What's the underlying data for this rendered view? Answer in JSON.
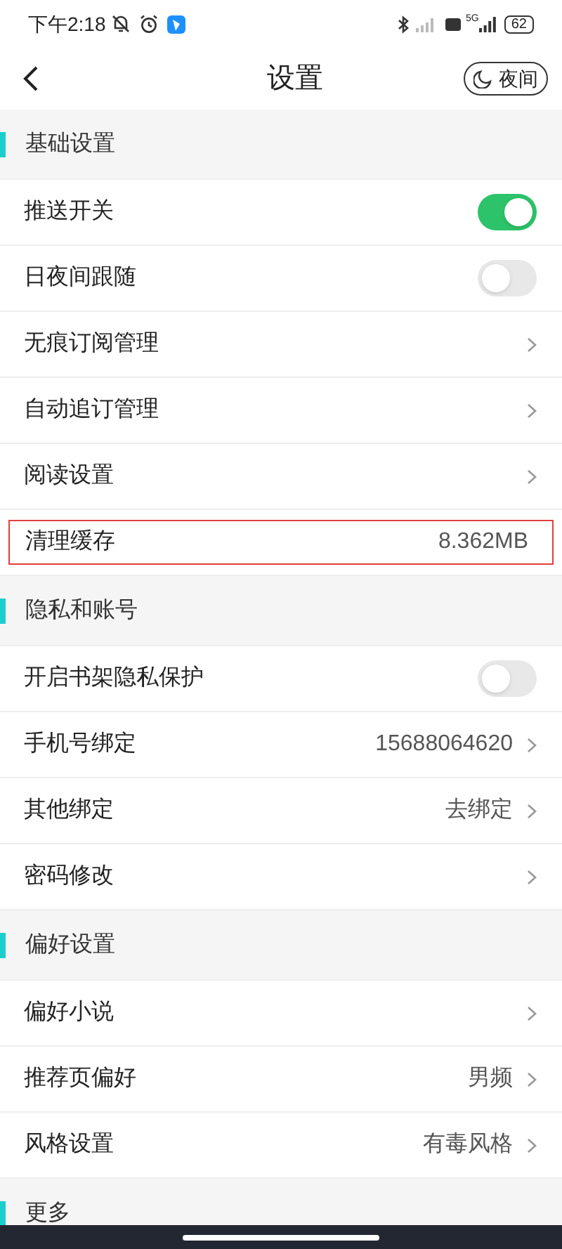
{
  "status_bar": {
    "time": "下午2:18",
    "network": "5G",
    "battery": "62"
  },
  "header": {
    "title": "设置",
    "night_button": "夜间"
  },
  "sections": [
    {
      "title": "基础设置",
      "items": [
        {
          "kind": "toggle",
          "label": "推送开关",
          "on": true
        },
        {
          "kind": "toggle",
          "label": "日夜间跟随",
          "on": false
        },
        {
          "kind": "link",
          "label": "无痕订阅管理"
        },
        {
          "kind": "link",
          "label": "自动追订管理"
        },
        {
          "kind": "link",
          "label": "阅读设置"
        },
        {
          "kind": "value",
          "label": "清理缓存",
          "value": "8.362MB",
          "highlighted": true
        }
      ]
    },
    {
      "title": "隐私和账号",
      "items": [
        {
          "kind": "toggle",
          "label": "开启书架隐私保护",
          "on": false
        },
        {
          "kind": "link",
          "label": "手机号绑定",
          "value": "15688064620"
        },
        {
          "kind": "link",
          "label": "其他绑定",
          "value": "去绑定"
        },
        {
          "kind": "link",
          "label": "密码修改"
        }
      ]
    },
    {
      "title": "偏好设置",
      "items": [
        {
          "kind": "link",
          "label": "偏好小说"
        },
        {
          "kind": "link",
          "label": "推荐页偏好",
          "value": "男频"
        },
        {
          "kind": "link",
          "label": "风格设置",
          "value": "有毒风格"
        }
      ]
    },
    {
      "title": "更多"
    }
  ]
}
